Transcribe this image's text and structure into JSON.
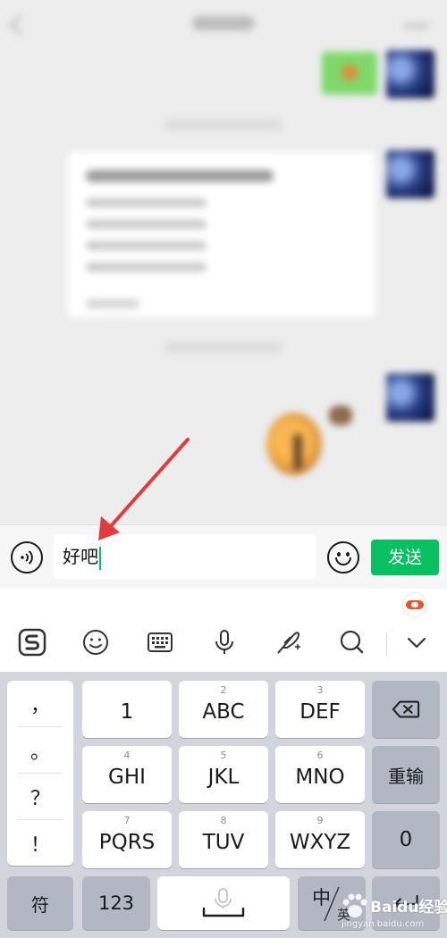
{
  "input": {
    "value": "好吧",
    "send_label": "发送"
  },
  "keyboard": {
    "punctuation": [
      "，",
      "。",
      "？",
      "！"
    ],
    "row1": [
      {
        "digit": "",
        "letters": "1"
      },
      {
        "digit": "2",
        "letters": "ABC"
      },
      {
        "digit": "3",
        "letters": "DEF"
      }
    ],
    "row2": [
      {
        "digit": "4",
        "letters": "GHI"
      },
      {
        "digit": "5",
        "letters": "JKL"
      },
      {
        "digit": "6",
        "letters": "MNO"
      }
    ],
    "row3": [
      {
        "digit": "7",
        "letters": "PQRS"
      },
      {
        "digit": "8",
        "letters": "TUV"
      },
      {
        "digit": "9",
        "letters": "WXYZ"
      }
    ],
    "reenter_label": "重输",
    "zero_label": "0",
    "symbol_label": "符",
    "numeric_label": "123",
    "lang_main": "中",
    "lang_sub": "英"
  },
  "watermark": {
    "brand": "Baidu经验",
    "url": "jingyan.baidu.com"
  },
  "colors": {
    "accent": "#07c160",
    "annotation": "#e23b3b"
  }
}
